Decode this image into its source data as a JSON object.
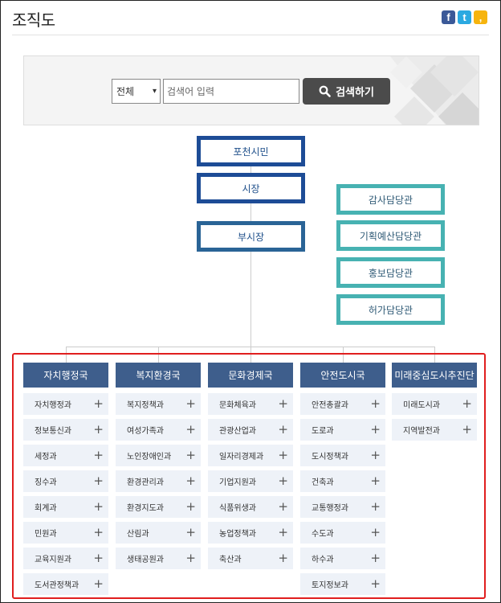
{
  "page": {
    "title": "조직도",
    "share": {
      "facebook": "f",
      "twitter": "t",
      "kakao": ","
    }
  },
  "search": {
    "select_value": "전체",
    "input_placeholder": "검색어 입력",
    "button_label": "검색하기"
  },
  "top_chain": [
    "포천시민",
    "시장",
    "부시장"
  ],
  "staff_offices": [
    "감사담당관",
    "기획예산담당관",
    "홍보담당관",
    "허가담당관"
  ],
  "bureaus": [
    {
      "name": "자치행정국",
      "depts": [
        "자치행정과",
        "정보통신과",
        "세정과",
        "징수과",
        "회계과",
        "민원과",
        "교육지원과",
        "도서관정책과"
      ]
    },
    {
      "name": "복지환경국",
      "depts": [
        "복지정책과",
        "여성가족과",
        "노인장애인과",
        "환경관리과",
        "환경지도과",
        "산림과",
        "생태공원과"
      ]
    },
    {
      "name": "문화경제국",
      "depts": [
        "문화체육과",
        "관광산업과",
        "일자리경제과",
        "기업지원과",
        "식품위생과",
        "농업정책과",
        "축산과"
      ]
    },
    {
      "name": "안전도시국",
      "depts": [
        "안전총괄과",
        "도로과",
        "도시정책과",
        "건축과",
        "교통행정과",
        "수도과",
        "하수과",
        "토지정보과"
      ]
    },
    {
      "name": "미래중심도시추진단",
      "depts": [
        "미래도시과",
        "지역발전과"
      ]
    }
  ],
  "colors": {
    "bureau_header": "#3e5e8c",
    "top_border": "#1d4c96",
    "staff_border": "#47b2b2",
    "highlight_frame": "#e01e1e",
    "search_button": "#4b4b4b"
  }
}
